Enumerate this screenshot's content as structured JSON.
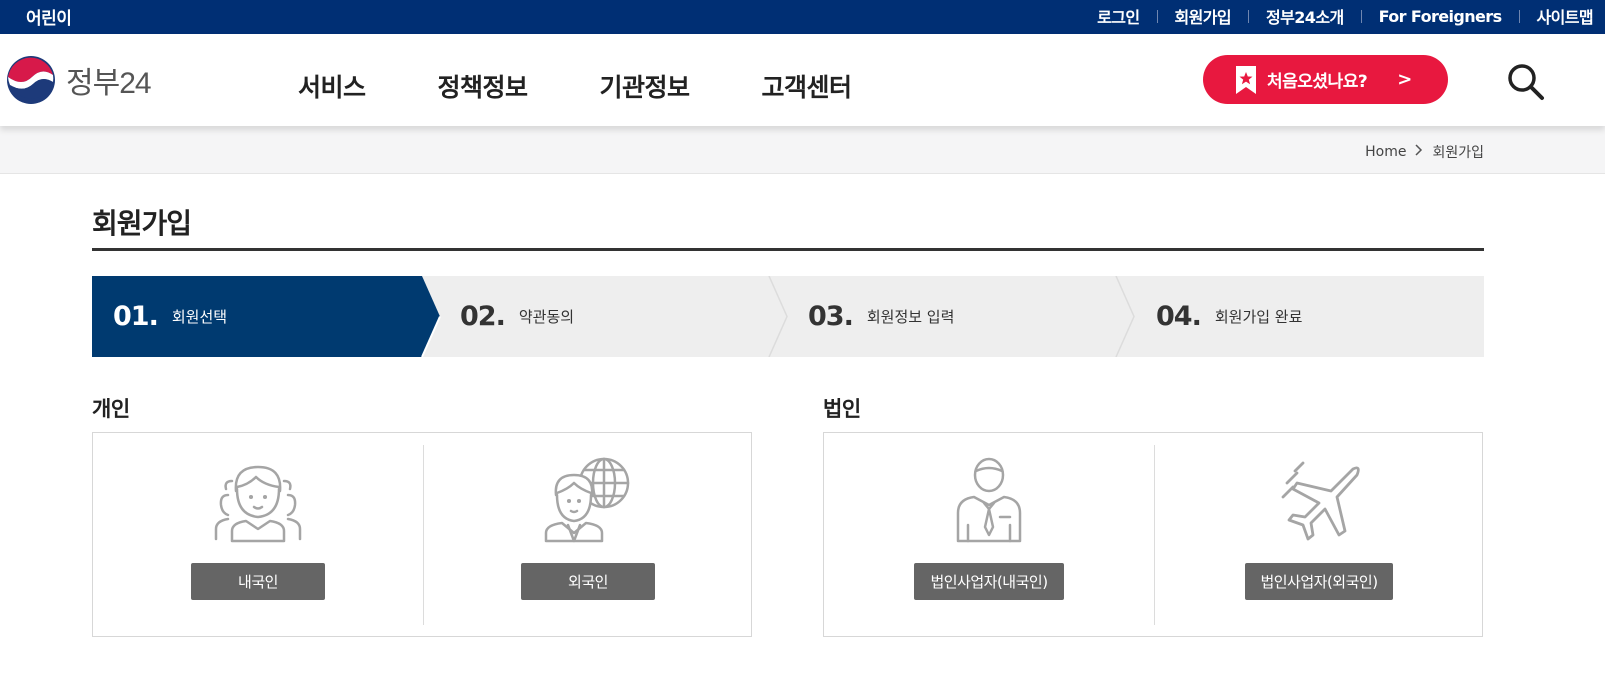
{
  "topbar": {
    "kids_label": "어린이",
    "links": [
      "로그인",
      "회원가입",
      "정부24소개",
      "For Foreigners",
      "사이트맵"
    ]
  },
  "header": {
    "logo_text": "정부24",
    "nav": [
      "서비스",
      "정책정보",
      "기관정보",
      "고객센터"
    ],
    "first_visit_label": "처음오셨나요?",
    "first_visit_arrow": ">",
    "colors": {
      "top_bar": "#002f74",
      "first_visit_button": "#e8183f",
      "active_step": "#003a70"
    }
  },
  "breadcrumb": {
    "home": "Home",
    "current": "회원가입"
  },
  "page": {
    "title": "회원가입"
  },
  "steps": [
    {
      "num": "01.",
      "label": "회원선택",
      "active": true
    },
    {
      "num": "02.",
      "label": "약관동의",
      "active": false
    },
    {
      "num": "03.",
      "label": "회원정보 입력",
      "active": false
    },
    {
      "num": "04.",
      "label": "회원가입 완료",
      "active": false
    }
  ],
  "personal": {
    "title": "개인",
    "options": [
      {
        "icon": "group-people-icon",
        "label": "내국인"
      },
      {
        "icon": "foreigner-globe-icon",
        "label": "외국인"
      }
    ]
  },
  "corporate": {
    "title": "법인",
    "options": [
      {
        "icon": "businessman-icon",
        "label": "법인사업자(내국인)"
      },
      {
        "icon": "airplane-icon",
        "label": "법인사업자(외국인)"
      }
    ]
  }
}
